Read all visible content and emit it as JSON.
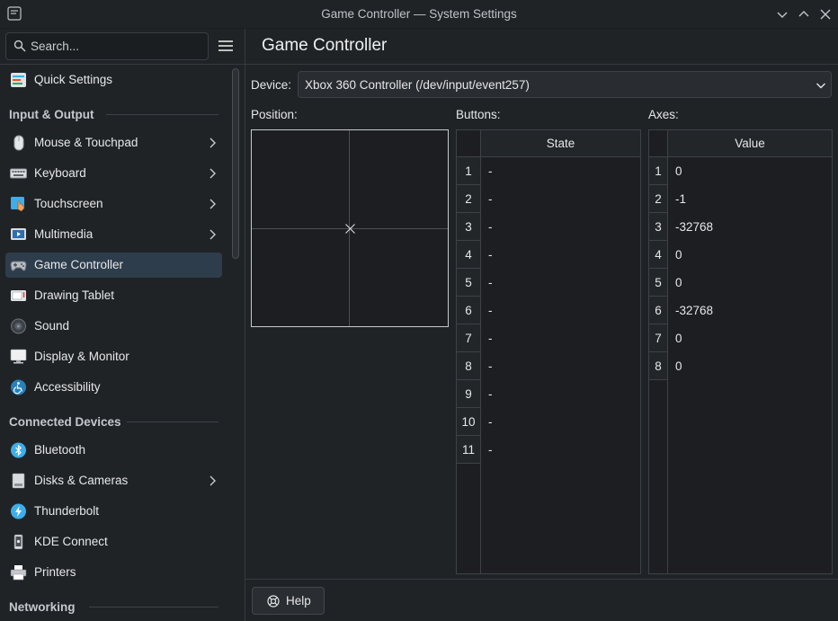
{
  "window": {
    "title": "Game Controller — System Settings"
  },
  "search": {
    "placeholder": "Search..."
  },
  "page": {
    "title": "Game Controller"
  },
  "sidebar": {
    "top_item": {
      "label": "Quick Settings"
    },
    "sections": [
      {
        "label": "Input & Output"
      },
      {
        "label": "Connected Devices"
      },
      {
        "label": "Networking"
      }
    ],
    "items": [
      {
        "label": "Mouse & Touchpad",
        "has_children": true
      },
      {
        "label": "Keyboard",
        "has_children": true
      },
      {
        "label": "Touchscreen",
        "has_children": true
      },
      {
        "label": "Multimedia",
        "has_children": true
      },
      {
        "label": "Game Controller",
        "selected": true
      },
      {
        "label": "Drawing Tablet"
      },
      {
        "label": "Sound"
      },
      {
        "label": "Display & Monitor"
      },
      {
        "label": "Accessibility"
      },
      {
        "label": "Bluetooth"
      },
      {
        "label": "Disks & Cameras",
        "has_children": true
      },
      {
        "label": "Thunderbolt"
      },
      {
        "label": "KDE Connect"
      },
      {
        "label": "Printers"
      }
    ]
  },
  "device": {
    "label": "Device:",
    "value": "Xbox 360 Controller (/dev/input/event257)"
  },
  "position": {
    "label": "Position:"
  },
  "buttons": {
    "label": "Buttons:",
    "column_header": "State",
    "rows": [
      {
        "n": "1",
        "state": "-"
      },
      {
        "n": "2",
        "state": "-"
      },
      {
        "n": "3",
        "state": "-"
      },
      {
        "n": "4",
        "state": "-"
      },
      {
        "n": "5",
        "state": "-"
      },
      {
        "n": "6",
        "state": "-"
      },
      {
        "n": "7",
        "state": "-"
      },
      {
        "n": "8",
        "state": "-"
      },
      {
        "n": "9",
        "state": "-"
      },
      {
        "n": "10",
        "state": "-"
      },
      {
        "n": "11",
        "state": "-"
      }
    ]
  },
  "axes": {
    "label": "Axes:",
    "column_header": "Value",
    "rows": [
      {
        "n": "1",
        "value": "0"
      },
      {
        "n": "2",
        "value": "-1"
      },
      {
        "n": "3",
        "value": "-32768"
      },
      {
        "n": "4",
        "value": "0"
      },
      {
        "n": "5",
        "value": "0"
      },
      {
        "n": "6",
        "value": "-32768"
      },
      {
        "n": "7",
        "value": "0"
      },
      {
        "n": "8",
        "value": "0"
      }
    ]
  },
  "footer": {
    "help_label": "Help"
  },
  "colors": {
    "selection": "#2e3d4c",
    "background": "#202326",
    "accent": "#3daee9"
  }
}
